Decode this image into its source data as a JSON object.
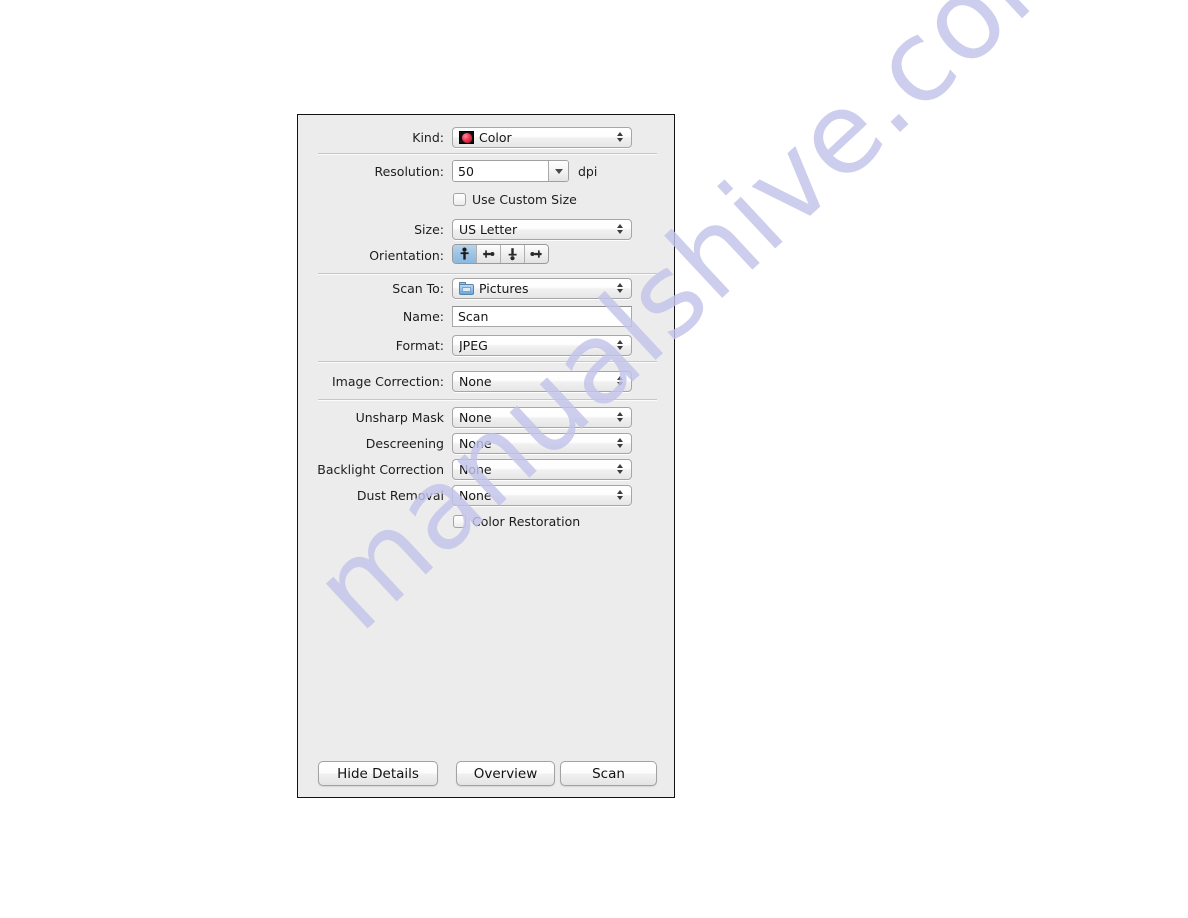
{
  "watermark": {
    "text": "manualshive.com"
  },
  "dialog": {
    "name": "scanner-settings-dialog",
    "rows": {
      "kind": {
        "label": "Kind:",
        "value": "Color",
        "icon": "color-thumbnail-icon"
      },
      "resolution": {
        "label": "Resolution:",
        "value": "50",
        "unit": "dpi"
      },
      "use_custom_size": {
        "label": "Use Custom Size",
        "checked": false
      },
      "size": {
        "label": "Size:",
        "value": "US Letter"
      },
      "orientation": {
        "label": "Orientation:",
        "selected_index": 0,
        "options": [
          "portrait-upright",
          "landscape-right",
          "portrait-upside-down",
          "landscape-left"
        ]
      },
      "scan_to": {
        "label": "Scan To:",
        "value": "Pictures",
        "icon": "blue-folder-icon"
      },
      "name": {
        "label": "Name:",
        "value": "Scan"
      },
      "format": {
        "label": "Format:",
        "value": "JPEG"
      },
      "image_correction": {
        "label": "Image Correction:",
        "value": "None"
      },
      "unsharp_mask": {
        "label": "Unsharp Mask",
        "value": "None"
      },
      "descreening": {
        "label": "Descreening",
        "value": "None"
      },
      "backlight_correction": {
        "label": "Backlight Correction",
        "value": "None"
      },
      "dust_removal": {
        "label": "Dust Removal",
        "value": "None"
      },
      "color_restoration": {
        "label": "Color Restoration",
        "checked": false
      }
    },
    "buttons": {
      "hide_details": "Hide Details",
      "overview": "Overview",
      "scan": "Scan"
    }
  },
  "colors": {
    "panel_bg": "#ececec",
    "panel_border": "#131313",
    "selected_segment": "#9dc3e4",
    "watermark": "#c3c3ea"
  }
}
